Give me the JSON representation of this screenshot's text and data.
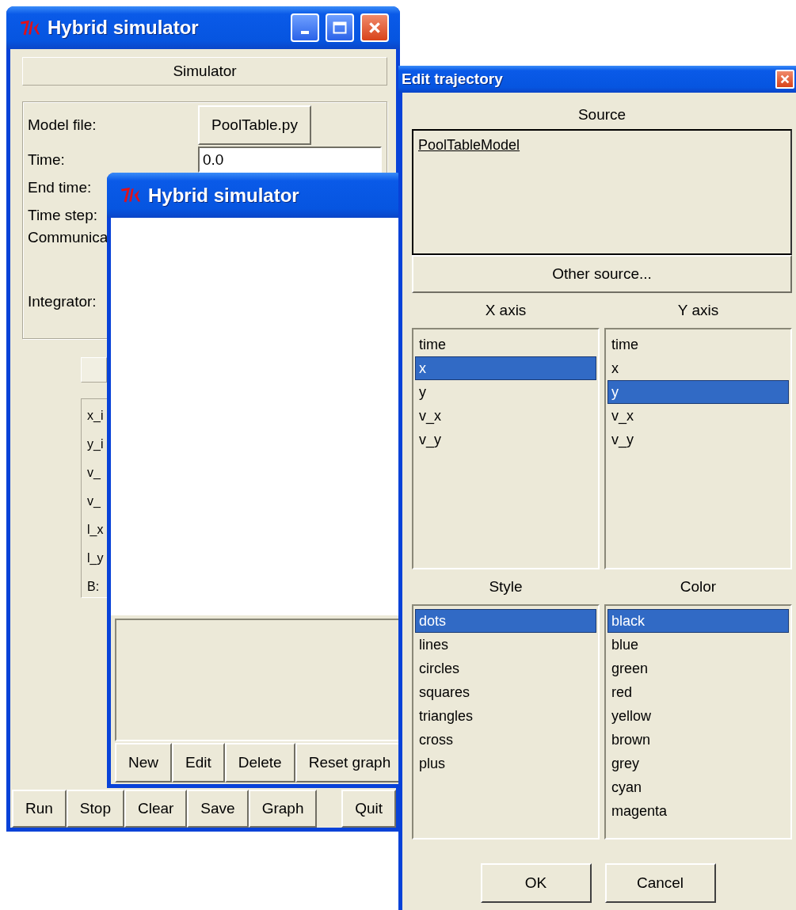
{
  "simulator_window": {
    "title": "Hybrid simulator",
    "header": "Simulator",
    "fields": [
      {
        "label": "Model file:",
        "kind": "button",
        "value": "PoolTable.py"
      },
      {
        "label": "Time:",
        "kind": "input",
        "value": "0.0"
      },
      {
        "label": "End time:",
        "kind": "label"
      },
      {
        "label": "Time step:",
        "kind": "label"
      },
      {
        "label": "Communica",
        "kind": "label"
      },
      {
        "label": "Integrator:",
        "kind": "label"
      }
    ],
    "variables": [
      "x_i",
      "y_i",
      "v_",
      "v_",
      "l_x",
      "l_y",
      "B:"
    ],
    "buttons": [
      "Run",
      "Stop",
      "Clear",
      "Save",
      "Graph",
      "Quit"
    ]
  },
  "graph_window": {
    "title": "Hybrid simulator",
    "buttons": [
      "New",
      "Edit",
      "Delete",
      "Reset graph"
    ]
  },
  "trajectory_dialog": {
    "title": "Edit trajectory",
    "source_label": "Source",
    "sources": [
      {
        "label": "PoolTableModel"
      }
    ],
    "other_source_button": "Other source...",
    "x_axis": {
      "label": "X axis",
      "items": [
        {
          "label": "time",
          "selected": false
        },
        {
          "label": "x",
          "selected": true
        },
        {
          "label": "y",
          "selected": false
        },
        {
          "label": "v_x",
          "selected": false
        },
        {
          "label": "v_y",
          "selected": false
        }
      ]
    },
    "y_axis": {
      "label": "Y axis",
      "items": [
        {
          "label": "time",
          "selected": false
        },
        {
          "label": "x",
          "selected": false
        },
        {
          "label": "y",
          "selected": true
        },
        {
          "label": "v_x",
          "selected": false
        },
        {
          "label": "v_y",
          "selected": false
        }
      ]
    },
    "style": {
      "label": "Style",
      "items": [
        {
          "label": "dots",
          "selected": true
        },
        {
          "label": "lines",
          "selected": false
        },
        {
          "label": "circles",
          "selected": false
        },
        {
          "label": "squares",
          "selected": false
        },
        {
          "label": "triangles",
          "selected": false
        },
        {
          "label": "cross",
          "selected": false
        },
        {
          "label": "plus",
          "selected": false
        }
      ]
    },
    "color": {
      "label": "Color",
      "items": [
        {
          "label": "black",
          "selected": true
        },
        {
          "label": "blue",
          "selected": false
        },
        {
          "label": "green",
          "selected": false
        },
        {
          "label": "red",
          "selected": false
        },
        {
          "label": "yellow",
          "selected": false
        },
        {
          "label": "brown",
          "selected": false
        },
        {
          "label": "grey",
          "selected": false
        },
        {
          "label": "cyan",
          "selected": false
        },
        {
          "label": "magenta",
          "selected": false
        }
      ]
    },
    "buttons": [
      "OK",
      "Cancel"
    ]
  }
}
